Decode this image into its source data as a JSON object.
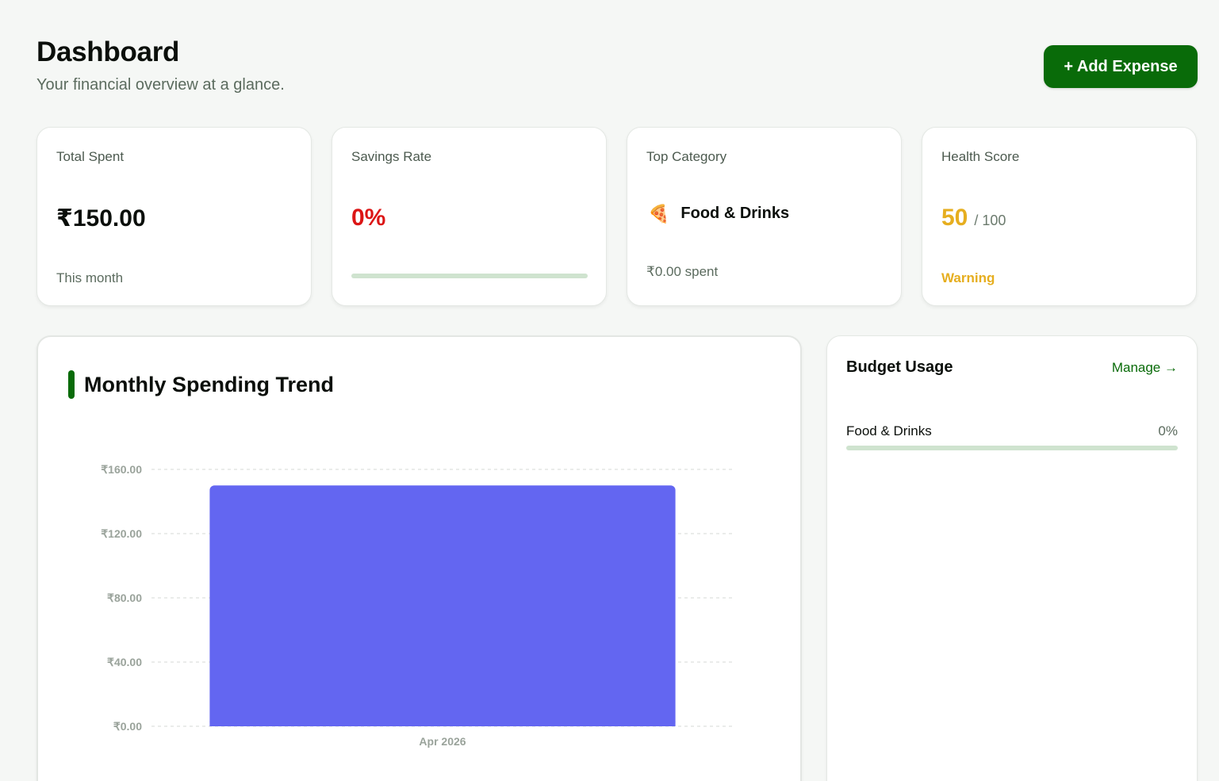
{
  "header": {
    "title": "Dashboard",
    "subtitle": "Your financial overview at a glance.",
    "add_button_label": "+ Add Expense"
  },
  "stats": {
    "total_spent": {
      "label": "Total Spent",
      "value": "₹150.00",
      "footnote": "This month"
    },
    "savings_rate": {
      "label": "Savings Rate",
      "value": "0%",
      "progress_percent": 0
    },
    "top_category": {
      "label": "Top Category",
      "icon": "pizza-icon",
      "emoji": "🍕",
      "name": "Food & Drinks",
      "spent": "₹0.00 spent"
    },
    "health_score": {
      "label": "Health Score",
      "value": "50",
      "max": "/ 100",
      "status": "Warning"
    }
  },
  "colors": {
    "brand_green": "#096b09",
    "bar": "#6366f1",
    "danger": "#dc1616",
    "warning": "#e6ae1f",
    "track": "#cfe3cf"
  },
  "trend": {
    "title": "Monthly Spending Trend"
  },
  "chart_data": {
    "type": "bar",
    "title": "Monthly Spending Trend",
    "categories": [
      "Apr 2026"
    ],
    "values": [
      150
    ],
    "ylim": [
      0,
      160
    ],
    "yticks": [
      0,
      40,
      80,
      120,
      160
    ],
    "ytick_labels": [
      "₹0.00",
      "₹40.00",
      "₹80.00",
      "₹120.00",
      "₹160.00"
    ],
    "xlabel": "",
    "ylabel": "",
    "grid": true,
    "bar_color": "#6366f1"
  },
  "budget": {
    "title": "Budget Usage",
    "manage_label": "Manage →",
    "items": [
      {
        "name": "Food & Drinks",
        "percent_label": "0%",
        "percent": 0
      }
    ]
  }
}
